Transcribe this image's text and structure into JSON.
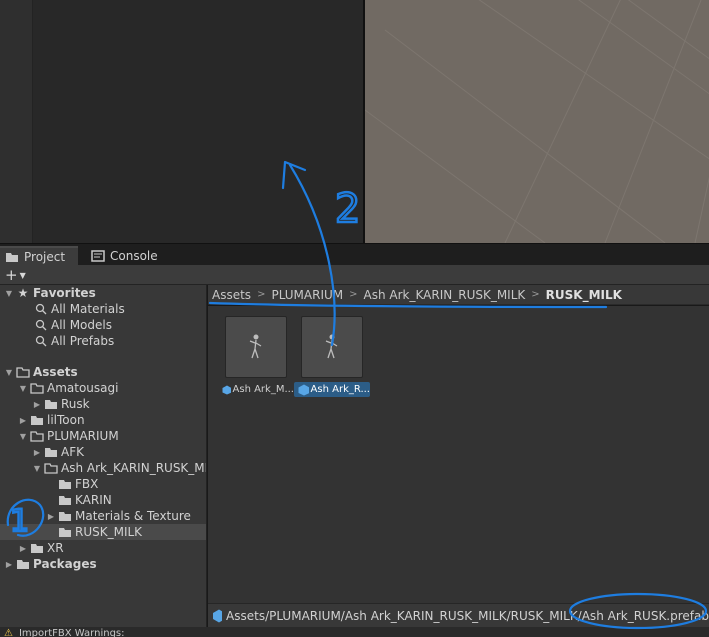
{
  "tabs": {
    "project_label": "Project",
    "console_label": "Console"
  },
  "toolbar": {
    "add_label": "+"
  },
  "tree": {
    "favorites": {
      "label": "Favorites",
      "items": [
        "All Materials",
        "All Models",
        "All Prefabs"
      ]
    },
    "assets_label": "Assets",
    "nodes": [
      {
        "label": "Amatousagi"
      },
      {
        "label": "Rusk"
      },
      {
        "label": "lilToon"
      },
      {
        "label": "PLUMARIUM"
      },
      {
        "label": "AFK"
      },
      {
        "label": "Ash Ark_KARIN_RUSK_MILK"
      },
      {
        "label": "FBX"
      },
      {
        "label": "KARIN"
      },
      {
        "label": "Materials & Texture"
      },
      {
        "label": "RUSK_MILK"
      },
      {
        "label": "XR"
      }
    ],
    "packages_label": "Packages"
  },
  "breadcrumb": {
    "items": [
      "Assets",
      "PLUMARIUM",
      "Ash Ark_KARIN_RUSK_MILK",
      "RUSK_MILK"
    ]
  },
  "assets": [
    {
      "label": "Ash Ark_M...",
      "selected": false
    },
    {
      "label": "Ash Ark_R...",
      "selected": true
    }
  ],
  "path_bar": {
    "path": "Assets/PLUMARIUM/Ash Ark_KARIN_RUSK_MILK/RUSK_MILK/Ash Ark_RUSK.prefab"
  },
  "status_bar": {
    "message": "ImportFBX Warnings:"
  },
  "annotations": {
    "step1": "1",
    "step2": "2"
  },
  "colors": {
    "annotation": "#1e7de0",
    "selection": "#2c5d87",
    "scene": "#716a63"
  }
}
